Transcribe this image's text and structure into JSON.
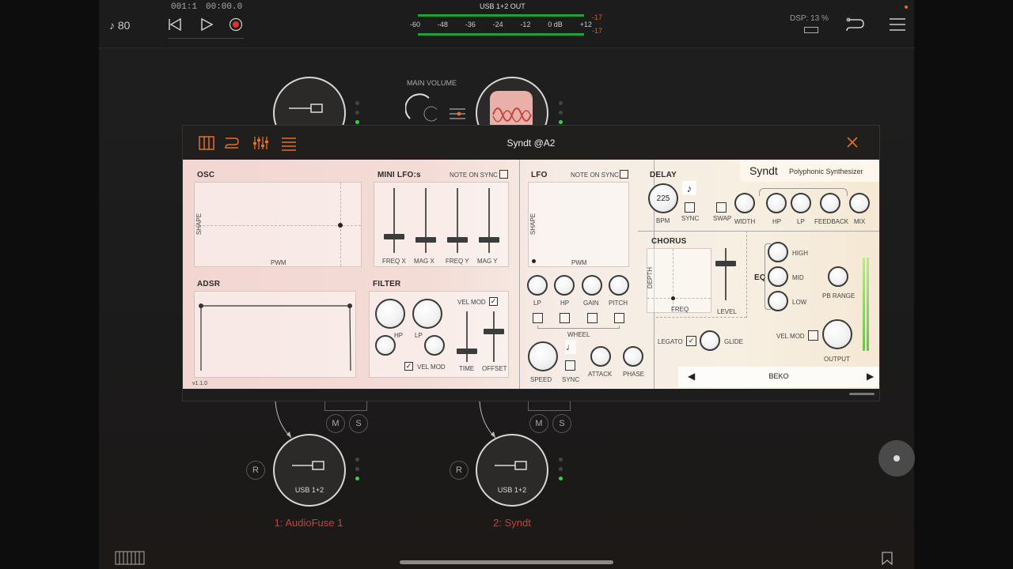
{
  "topbar": {
    "tempo": "♪ 80",
    "position": "001:1",
    "time": "00:00.0",
    "output_label": "USB 1+2 OUT",
    "meter_scale": [
      "-60",
      "-48",
      "-36",
      "-24",
      "-12",
      "0 dB",
      "+12"
    ],
    "peak_l": "-17",
    "peak_r": "-17",
    "dsp": "DSP: 13 %"
  },
  "main_volume": "MAIN VOLUME",
  "tracks": [
    {
      "name": "1: AudioFuse 1",
      "input": "USB 1+2",
      "m": "M",
      "s": "S",
      "r": "R"
    },
    {
      "name": "2: Syndt",
      "input": "USB 1+2",
      "m": "M",
      "s": "S",
      "r": "R"
    }
  ],
  "plugin": {
    "title": "Syndt @A2",
    "brand": "Syndt",
    "brand_sub": "Polyphonic Synthesizer",
    "version": "v1.1.0",
    "osc": {
      "title": "OSC",
      "x_label": "PWM",
      "y_label": "SHAPE"
    },
    "mini_lfo": {
      "title": "MINI LFO:s",
      "note_on_sync": "NOTE ON SYNC",
      "sliders": [
        "FREQ X",
        "MAG X",
        "FREQ Y",
        "MAG Y"
      ],
      "slider_values": [
        0.25,
        0.2,
        0.2,
        0.2
      ]
    },
    "lfo": {
      "title": "LFO",
      "note_on_sync": "NOTE ON SYNC",
      "x_label": "PWM",
      "y_label": "SHAPE",
      "knobs": [
        "LP",
        "HP",
        "GAIN",
        "PITCH"
      ],
      "wheel": "WHEEL",
      "speed": "SPEED",
      "sync": "SYNC",
      "attack": "ATTACK",
      "phase": "PHASE"
    },
    "adsr": {
      "title": "ADSR"
    },
    "filter": {
      "title": "FILTER",
      "vel_mod": "VEL MOD",
      "hp": "HP",
      "lp": "LP",
      "vel_mod2": "VEL MOD",
      "time": "TIME",
      "offset": "OFFSET",
      "time_value": 0.2,
      "offset_value": 0.6
    },
    "delay": {
      "title": "DELAY",
      "bpm_value": "225",
      "bpm": "BPM",
      "sync": "SYNC",
      "swap": "SWAP",
      "width": "WIDTH",
      "hp": "HP",
      "lp": "LP",
      "feedback": "FEEDBACK",
      "mix": "MIX"
    },
    "chorus": {
      "title": "CHORUS",
      "depth": "DEPTH",
      "freq": "FREQ",
      "level": "LEVEL",
      "level_value": 0.7
    },
    "eq": {
      "title": "EQ",
      "high": "HIGH",
      "mid": "MID",
      "low": "LOW",
      "pb_range": "PB RANGE"
    },
    "legato": "LEGATO",
    "glide": "GLIDE",
    "vel_mod": "VEL MOD",
    "output": "OUTPUT",
    "preset": "BEKO"
  },
  "colors": {
    "accent": "#e0702a",
    "led_green": "#2fd34a",
    "track_name": "#c0453f",
    "peak": "#e05a2a"
  }
}
